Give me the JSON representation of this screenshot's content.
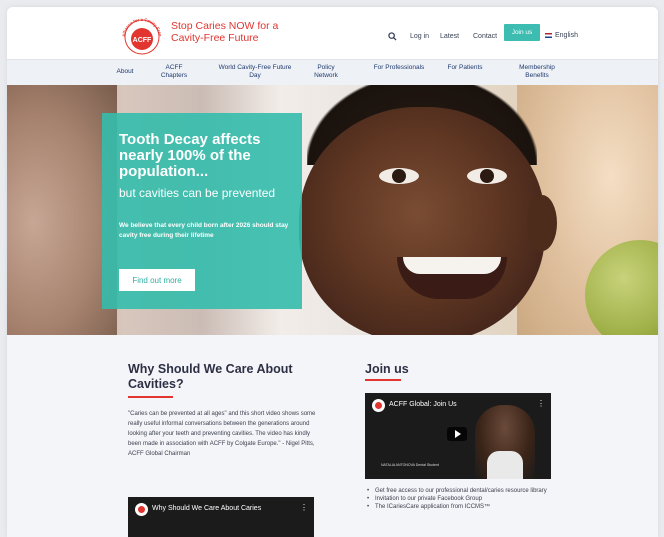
{
  "header": {
    "tagline": "Stop Caries NOW for a Cavity-Free Future",
    "logo_text": "ACFF",
    "logo_arc_text": "Alliance for a Cavity-Free Future",
    "util_links": [
      "Log in",
      "Latest",
      "Contact"
    ],
    "join_label": "Join us",
    "language": "English"
  },
  "nav": {
    "items": [
      "About",
      "ACFF Chapters",
      "World Cavity-Free Future Day",
      "Policy Network",
      "For Professionals",
      "For Patients",
      "Membership Benefits"
    ]
  },
  "hero": {
    "title": "Tooth Decay affects nearly 100% of the population...",
    "subtitle": "but cavities can be prevented",
    "body": "We believe that every child born after 2026 should stay cavity free during their lifetime",
    "cta": "Find out more"
  },
  "why": {
    "title": "Why Should We Care About Cavities?",
    "quote": "\"Caries can be prevented at all ages\" and this short video shows some really useful informal conversations between the generations around looking after your teeth and preventing cavities. The video has kindly been made in association with ACFF by Colgate Europe.\" - Nigel Pitts, ACFF Global Chairman",
    "video_title": "Why Should We Care About Caries"
  },
  "join": {
    "title": "Join us",
    "video_title": "ACFF Global: Join Us",
    "video_caption": "NATALIA ANTONOVA Dental Student",
    "benefits": [
      "Get free access to our professional dental/caries resource library",
      "Invitation to our private Facebook Group",
      "The ICariesCare application from ICCMS™"
    ]
  },
  "colors": {
    "accent_teal": "#3dbcb1",
    "brand_red": "#e2352f",
    "nav_text": "#1f3a6e"
  }
}
